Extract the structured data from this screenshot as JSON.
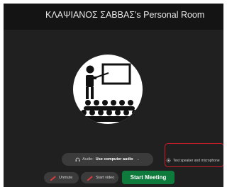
{
  "window": {
    "title": "ΚΛΑΨΙΑΝΟΣ ΣΑΒΒΑΣ's Personal Room"
  },
  "audio": {
    "prefix": "Audio:",
    "value": "Use computer audio"
  },
  "test_link": {
    "label": "Test speaker and microphone"
  },
  "controls": {
    "unmute_label": "Unmute",
    "start_video_label": "Start video",
    "start_meeting_label": "Start Meeting"
  },
  "colors": {
    "background": "#202020",
    "start_button": "#0e7a3b",
    "highlight_border": "#d11c2a"
  },
  "icons": {
    "illustration": "presenter-audience-illustration",
    "audio": "headset-icon",
    "test": "gear-icon",
    "mute": "mic-muted-icon",
    "video": "video-off-icon"
  }
}
